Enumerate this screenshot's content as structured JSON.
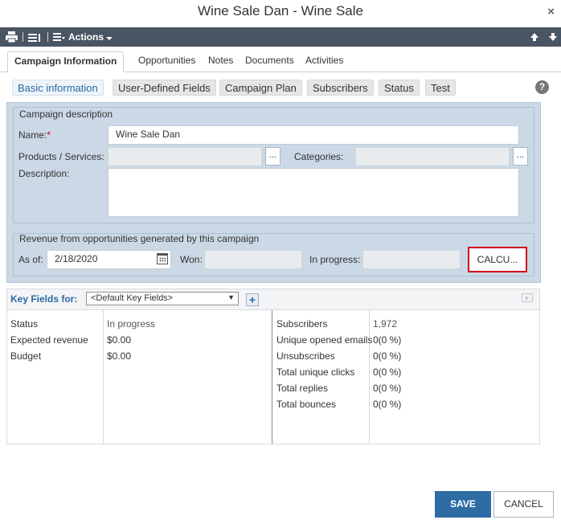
{
  "window": {
    "title": "Wine Sale Dan - Wine Sale",
    "close_glyph": "×"
  },
  "toolbar": {
    "actions_label": "Actions",
    "up_glyph": "⬆",
    "down_glyph": "⬇"
  },
  "main_tabs": [
    "Campaign Information",
    "Opportunities",
    "Notes",
    "Documents",
    "Activities"
  ],
  "sub_tabs": [
    "Basic information",
    "User-Defined Fields",
    "Campaign Plan",
    "Subscribers",
    "Status",
    "Test"
  ],
  "help_glyph": "?",
  "description_group": {
    "title": "Campaign description",
    "name_label": "Name:",
    "required_mark": "*",
    "name_value": "Wine Sale Dan",
    "products_label": "Products / Services:",
    "products_value": "",
    "categories_label": "Categories:",
    "categories_value": "",
    "description_label": "Description:",
    "description_value": "",
    "dots_label": "..."
  },
  "revenue_group": {
    "title": "Revenue from opportunities generated by this campaign",
    "as_of_label": "As of:",
    "as_of_value": "2/18/2020",
    "won_label": "Won:",
    "won_value": "",
    "in_progress_label": "In progress:",
    "in_progress_value": "",
    "calculate_label": "CALCU..."
  },
  "key_fields": {
    "label": "Key Fields for:",
    "selected": "<Default Key Fields>",
    "plus_glyph": "+",
    "left": [
      {
        "label": "Status",
        "value": "In progress"
      },
      {
        "label": "Expected revenue",
        "value": "$0.00"
      },
      {
        "label": "Budget",
        "value": "$0.00"
      }
    ],
    "right": [
      {
        "label": "Subscribers",
        "value": "1,972"
      },
      {
        "label": "Unique opened emails",
        "value": "0(0 %)"
      },
      {
        "label": "Unsubscribes",
        "value": "0(0 %)"
      },
      {
        "label": "Total unique clicks",
        "value": "0(0 %)"
      },
      {
        "label": "Total replies",
        "value": "0(0 %)"
      },
      {
        "label": "Total bounces",
        "value": "0(0 %)"
      }
    ]
  },
  "buttons": {
    "save": "SAVE",
    "cancel": "CANCEL"
  }
}
